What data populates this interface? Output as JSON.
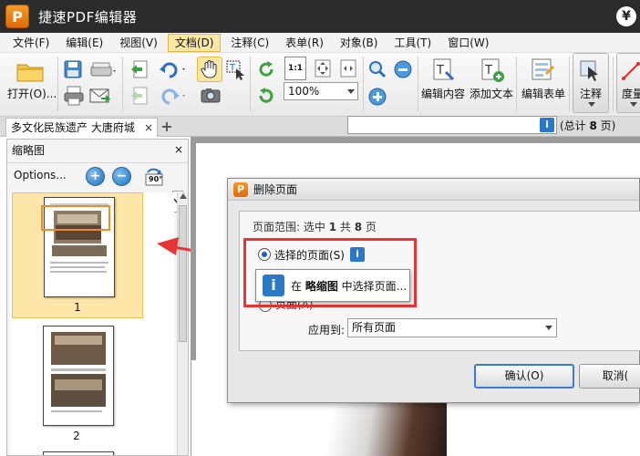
{
  "app": {
    "logo_letter": "P",
    "title": "捷速PDF编辑器",
    "corner_icon": "¥"
  },
  "menu": [
    "文件(F)",
    "编辑(E)",
    "视图(V)",
    "文档(D)",
    "注释(C)",
    "表单(R)",
    "对象(B)",
    "工具(T)",
    "窗口(W)"
  ],
  "toolbar": {
    "open_label": "打开(O)...",
    "zoom_value": "100%",
    "edit_content_label": "编辑内容",
    "add_text_label": "添加文本",
    "edit_form_label": "编辑表单",
    "annotate_label": "注释",
    "measure_label": "度量",
    "one_to_one": "1:1"
  },
  "tabs": {
    "doc_tab": "多文化民族遗产 大唐府城",
    "close": "×",
    "new_tab": "+"
  },
  "sidebar": {
    "title": "缩略图",
    "close": "×",
    "options_label": "Options...",
    "rotate_label": "90°",
    "pages": [
      {
        "number": "1",
        "selected": true
      },
      {
        "number": "2",
        "selected": false
      }
    ]
  },
  "dialog": {
    "logo_letter": "P",
    "title": "删除页面",
    "range_prefix": "页面范围: 选中 ",
    "range_count": "1",
    "range_mid": " 共 ",
    "range_total": "8",
    "range_suffix": " 页",
    "radio_selected_label": "选择的页面(S)",
    "radio_pages_label": "页面(A)",
    "total_prefix": "(总计 ",
    "total_count": "8",
    "total_suffix": " 页)",
    "apply_label": "应用到:",
    "apply_value": "所有页面",
    "ok_label": "确认(O)",
    "cancel_label": "取消(",
    "info_glyph": "i"
  },
  "tooltip": {
    "prefix": "在 ",
    "bold": "略缩图",
    "suffix": " 中选择页面..."
  },
  "colors": {
    "highlight_red": "#e63535",
    "selection_yellow": "#fde6a7",
    "info_blue": "#2b78c7",
    "brand_orange": "#f39a2a"
  }
}
